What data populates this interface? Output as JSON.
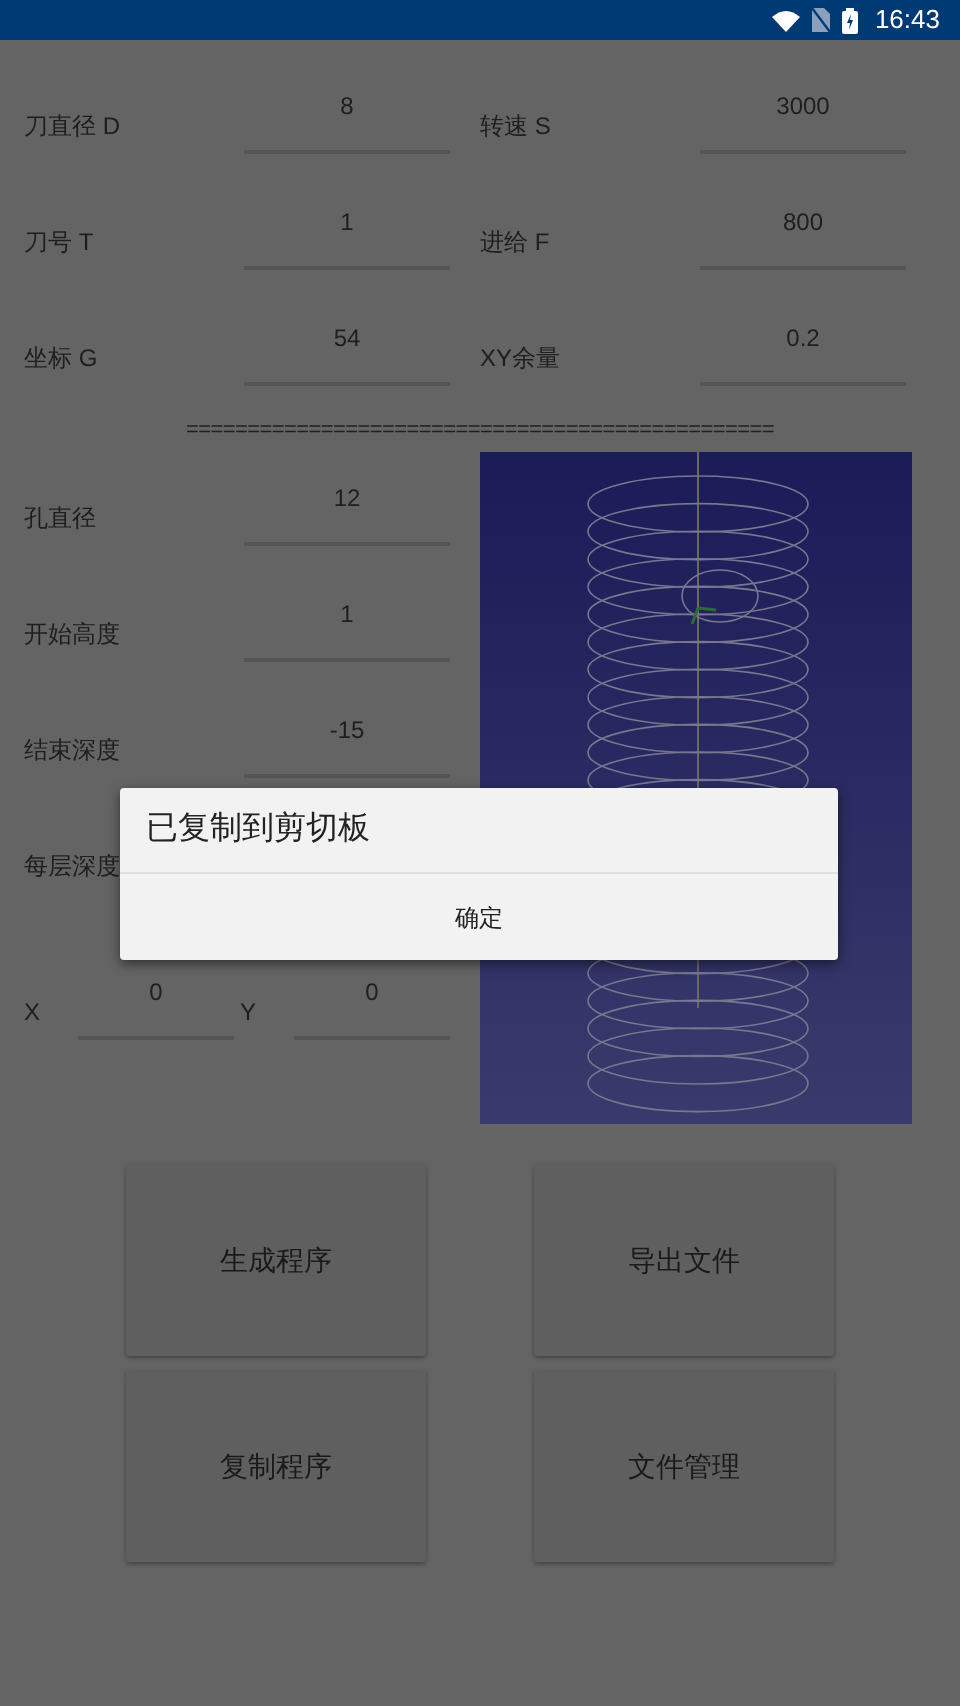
{
  "status_bar": {
    "time": "16:43"
  },
  "params": [
    {
      "label": "刀直径 D",
      "value": "8"
    },
    {
      "label": "转速 S",
      "value": "3000"
    },
    {
      "label": "刀号 T",
      "value": "1"
    },
    {
      "label": "进给 F",
      "value": "800"
    },
    {
      "label": "坐标 G",
      "value": "54"
    },
    {
      "label": "XY余量",
      "value": "0.2"
    }
  ],
  "separator": "================================================",
  "hole_fields": [
    {
      "label": "孔直径",
      "value": "12"
    },
    {
      "label": "开始高度",
      "value": "1"
    },
    {
      "label": "结束深度",
      "value": "-15"
    },
    {
      "label": "每层深度"
    }
  ],
  "coords": [
    {
      "label": "X",
      "value": "0"
    },
    {
      "label": "Y",
      "value": "0"
    }
  ],
  "buttons": [
    "生成程序",
    "导出文件",
    "复制程序",
    "文件管理"
  ],
  "dialog": {
    "message": "已复制到剪切板",
    "button": "确定"
  }
}
